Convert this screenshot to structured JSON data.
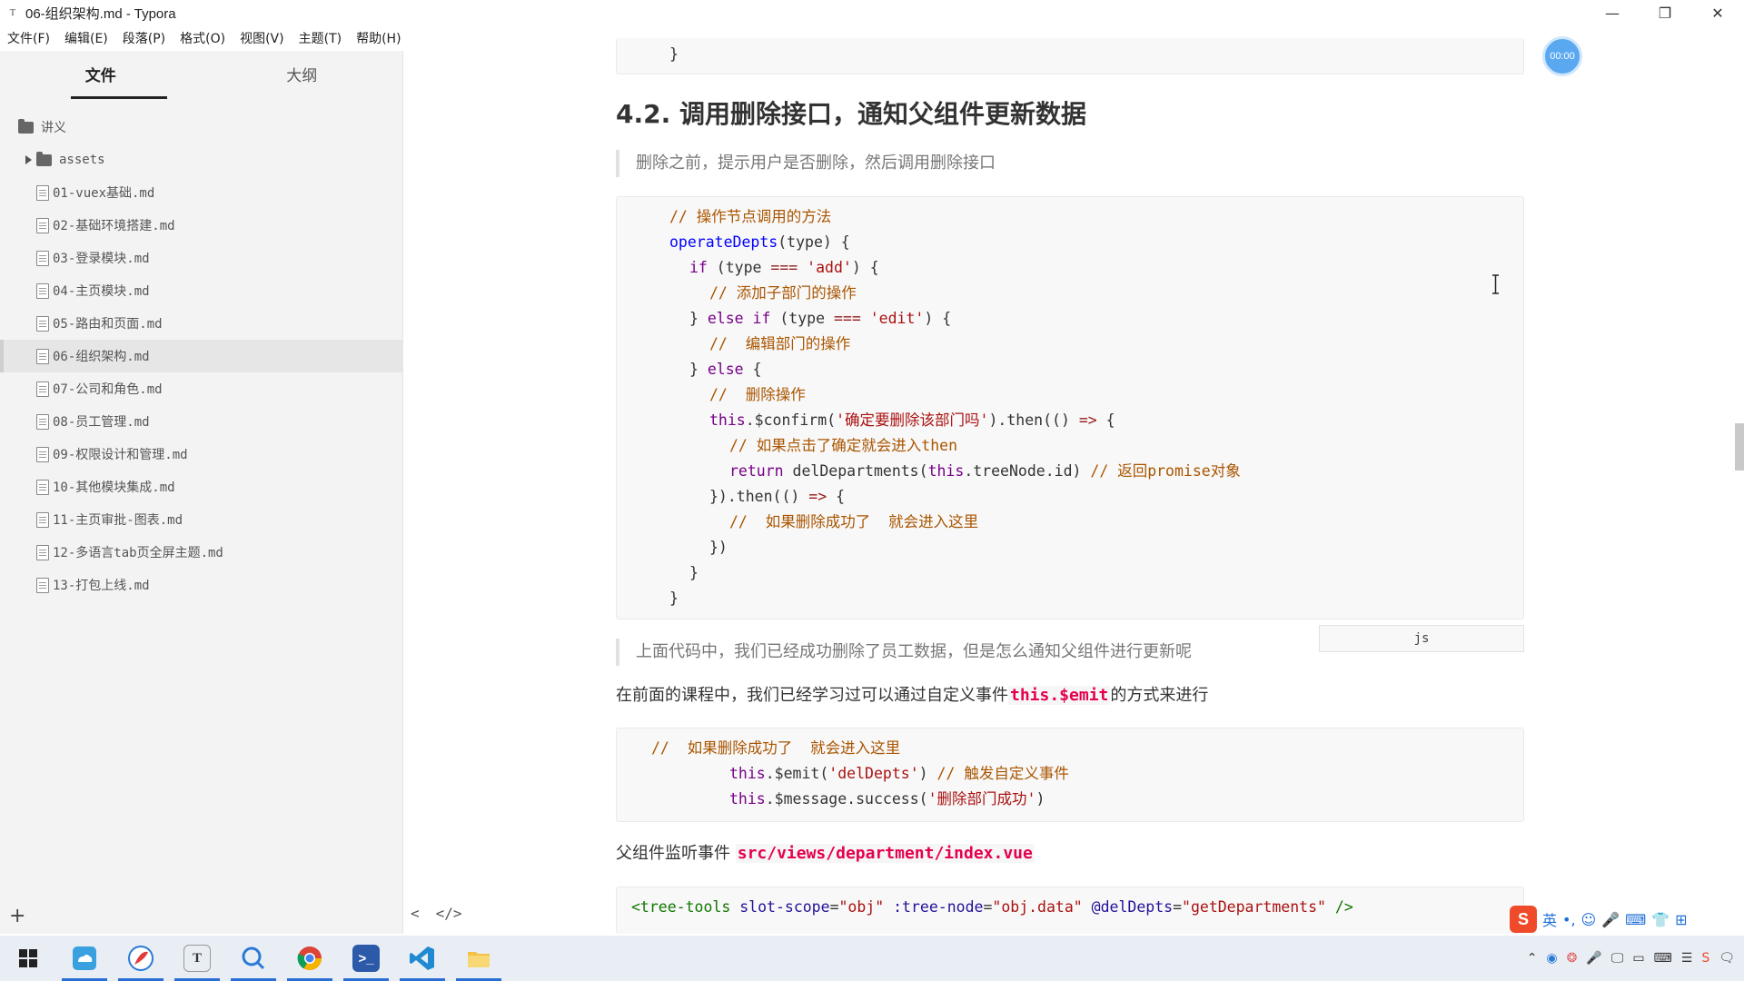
{
  "window": {
    "title": "06-组织架构.md - Typora",
    "app_icon": "T"
  },
  "menu": [
    "文件(F)",
    "编辑(E)",
    "段落(P)",
    "格式(O)",
    "视图(V)",
    "主题(T)",
    "帮助(H)"
  ],
  "sidebar": {
    "tabs": {
      "files": "文件",
      "outline": "大纲"
    },
    "root_folder": "讲义",
    "subfolder": "assets",
    "files": [
      "01-vuex基础.md",
      "02-基础环境搭建.md",
      "03-登录模块.md",
      "04-主页模块.md",
      "05-路由和页面.md",
      "06-组织架构.md",
      "07-公司和角色.md",
      "08-员工管理.md",
      "09-权限设计和管理.md",
      "10-其他模块集成.md",
      "11-主页审批-图表.md",
      "12-多语言tab页全屏主题.md",
      "13-打包上线.md"
    ],
    "selected_file": "06-组织架构.md",
    "add_symbol": "+"
  },
  "editor_toggles": {
    "collapse": "<",
    "source": "</>"
  },
  "doc": {
    "top_brace": "}",
    "heading": "4.2. 调用删除接口，通知父组件更新数据",
    "quote1": "删除之前，提示用户是否删除，然后调用删除接口",
    "code1": {
      "l1": "// 操作节点调用的方法",
      "l2a": "operateDepts",
      "l2b": "(type) {",
      "l3a": "if",
      "l3b": " (type ",
      "l3c": "===",
      "l3d": " ",
      "l3e": "'add'",
      "l3f": ") {",
      "l4": "// 添加子部门的操作",
      "l5a": "} ",
      "l5b": "else if",
      "l5c": " (type ",
      "l5d": "===",
      "l5e": " ",
      "l5f": "'edit'",
      "l5g": ") {",
      "l6": "//  编辑部门的操作",
      "l7a": "} ",
      "l7b": "else",
      "l7c": " {",
      "l8": "//  删除操作",
      "l9a": "this",
      "l9b": ".$confirm(",
      "l9c": "'确定要删除该部门吗'",
      "l9d": ").then(() ",
      "l9e": "=>",
      "l9f": " {",
      "l10": "// 如果点击了确定就会进入then",
      "l11a": "return",
      "l11b": " delDepartments(",
      "l11c": "this",
      "l11d": ".treeNode.id) ",
      "l11e": "// 返回promise对象",
      "l12a": "}).then(() ",
      "l12b": "=>",
      "l12c": " {",
      "l13": "//  如果删除成功了  就会进入这里",
      "l14": "})",
      "l15": "}",
      "l16": "}"
    },
    "lang_tag": "js",
    "quote2": "上面代码中，我们已经成功删除了员工数据，但是怎么通知父组件进行更新呢",
    "para1_text": "在前面的课程中，我们已经学习过可以通过自定义事件",
    "para1_code": "this.$emit",
    "para1_tail": "的方式来进行",
    "code2": {
      "l1": "//  如果删除成功了  就会进入这里",
      "l2a": "this",
      "l2b": ".$emit(",
      "l2c": "'delDepts'",
      "l2d": ") ",
      "l2e": "// 触发自定义事件",
      "l3a": "this",
      "l3b": ".$message.success(",
      "l3c": "'删除部门成功'",
      "l3d": ")"
    },
    "para2_text": "父组件监听事件 ",
    "para2_code": "src/views/department/index.vue",
    "code3": {
      "a": "<tree-tools",
      "b": " slot-scope",
      "c": "=",
      "d": "\"obj\"",
      "e": " :tree-node",
      "f": "=",
      "g": "\"obj.data\"",
      "h": " @delDepts",
      "i": "=",
      "j": "\"getDepartments\"",
      "k": " />"
    }
  },
  "timer": "00:00",
  "ime": {
    "logo": "S",
    "mode": "英",
    "punct": "•,",
    "items": [
      "☺",
      "🎤",
      "⌨",
      "👕",
      "⊞"
    ]
  },
  "colors": {
    "sidebar_bg": "#f3f3f3",
    "code_bg": "#f8f8f8",
    "inline_code": "#e5004f",
    "taskbar_bg": "#e9eef5"
  }
}
